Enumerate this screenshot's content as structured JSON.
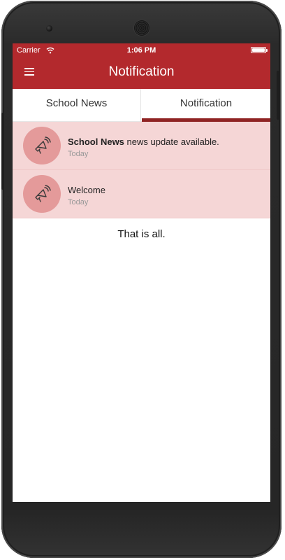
{
  "status_bar": {
    "carrier": "Carrier",
    "time": "1:06 PM"
  },
  "header": {
    "title": "Notification",
    "color": "#b3292d"
  },
  "tabs": [
    {
      "label": "School News",
      "active": false
    },
    {
      "label": "Notification",
      "active": true
    }
  ],
  "notifications": [
    {
      "title_bold": "School News",
      "title_rest": " news update available.",
      "time": "Today",
      "icon": "megaphone-icon"
    },
    {
      "title_bold": "",
      "title_rest": "Welcome",
      "time": "Today",
      "icon": "megaphone-icon"
    }
  ],
  "end_message": "That is all.",
  "colors": {
    "accent": "#b3292d",
    "tab_indicator": "#8f2323",
    "unread_row": "#f5d6d6",
    "avatar_bg": "#e49a9a"
  }
}
